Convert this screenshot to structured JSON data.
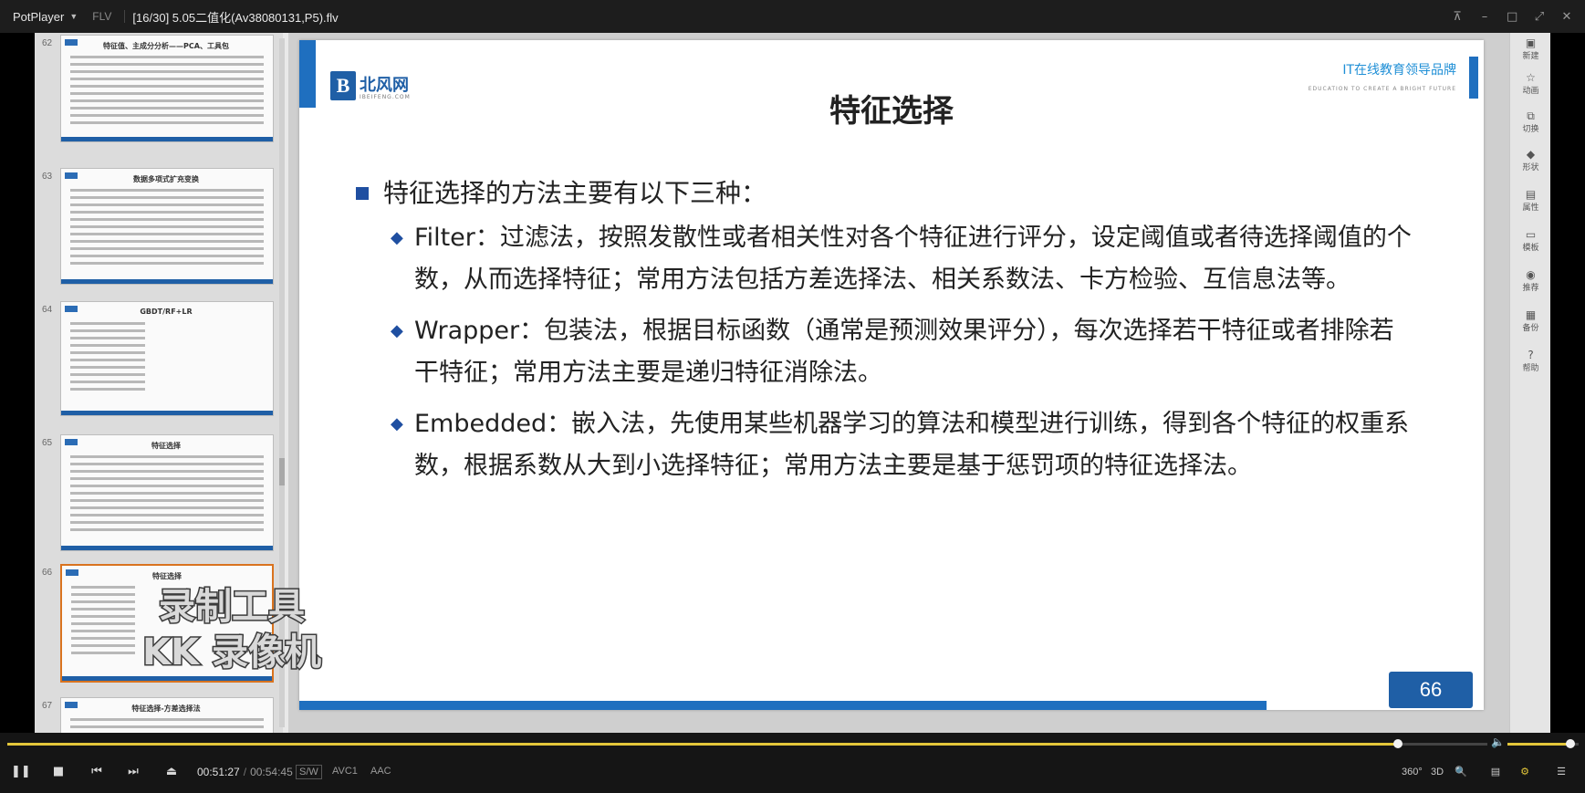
{
  "titlebar": {
    "app_name": "PotPlayer",
    "format": "FLV",
    "file_title": "[16/30] 5.05二值化(Av38080131,P5).flv",
    "window_buttons": [
      "pin-icon",
      "minimize-icon",
      "maximize-icon",
      "fullscreen-icon",
      "close-icon"
    ]
  },
  "thumbnails": [
    {
      "num": "62",
      "title": "特征值、主成分分析——PCA、工具包"
    },
    {
      "num": "63",
      "title": "数据多项式扩充变换"
    },
    {
      "num": "64",
      "title": "GBDT/RF+LR"
    },
    {
      "num": "65",
      "title": "特征选择"
    },
    {
      "num": "66",
      "title": "特征选择"
    },
    {
      "num": "67",
      "title": "特征选择-方差选择法"
    }
  ],
  "slide": {
    "logo_cn": "北风网",
    "logo_en": "IBEIFENG.COM",
    "slogan_cn": "IT在线教育领导品牌",
    "slogan_en": "EDUCATION TO CREATE A BRIGHT FUTURE",
    "title": "特征选择",
    "main_point": "特征选择的方法主要有以下三种：",
    "sub_points": [
      {
        "text": "Filter：过滤法，按照发散性或者相关性对各个特征进行评分，设定阈值或者待选择阈值的个数，从而选择特征；常用方法包括方差选择法、相关系数法、卡方检验、互信息法等。"
      },
      {
        "text": "Wrapper：包装法，根据目标函数（通常是预测效果评分），每次选择若干特征或者排除若干特征；常用方法主要是递归特征消除法。"
      },
      {
        "text": "Embedded：嵌入法，先使用某些机器学习的算法和模型进行训练，得到各个特征的权重系数，根据系数从大到小选择特征；常用方法主要是基于惩罚项的特征选择法。"
      }
    ],
    "page_number": "66"
  },
  "watermark": {
    "line1": "录制工具",
    "line2": "KK 录像机"
  },
  "tools": [
    {
      "icon": "new-slide-icon",
      "label": "新建"
    },
    {
      "icon": "animation-icon",
      "label": "动画"
    },
    {
      "icon": "transition-icon",
      "label": "切换"
    },
    {
      "icon": "shape-icon",
      "label": "形状"
    },
    {
      "icon": "properties-icon",
      "label": "属性"
    },
    {
      "icon": "template-icon",
      "label": "模板"
    },
    {
      "icon": "navigation-icon",
      "label": "推荐"
    },
    {
      "icon": "backup-icon",
      "label": "备份"
    },
    {
      "icon": "help-icon",
      "label": "帮助"
    }
  ],
  "player": {
    "progress": 0.9393,
    "volume": 0.88,
    "current_time": "00:51:27",
    "total_time": "00:54:45",
    "sw_badge": "S/W",
    "video_codec": "AVC1",
    "audio_codec": "AAC",
    "right_buttons": [
      "360°",
      "3D",
      "🔍",
      "▤",
      "⚙",
      "☰"
    ]
  }
}
